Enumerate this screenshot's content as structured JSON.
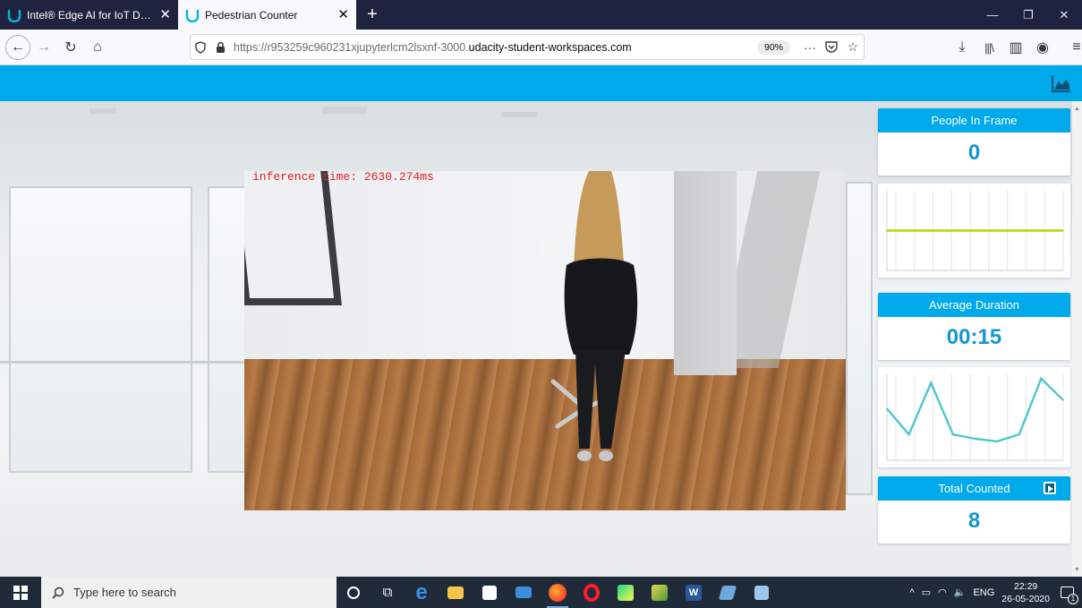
{
  "browser": {
    "tabs": [
      {
        "label": "Intel® Edge AI for IoT Develope",
        "active": false
      },
      {
        "label": "Pedestrian Counter",
        "active": true
      }
    ],
    "url": {
      "prefix": "https://r953259c960231xjupyterlcm2lsxnf-3000.",
      "domain": "udacity-student-workspaces.com"
    },
    "zoom": "90%"
  },
  "video": {
    "inference_text": "inference time: 2630.274ms"
  },
  "stats": {
    "people_in_frame": {
      "label": "People In Frame",
      "value": "0"
    },
    "average_duration": {
      "label": "Average Duration",
      "value": "00:15"
    },
    "total_counted": {
      "label": "Total Counted",
      "value": "8"
    }
  },
  "chart_data": [
    {
      "type": "line",
      "title": "",
      "series": [
        {
          "values": [
            50,
            50,
            50,
            50,
            50,
            50,
            50,
            50,
            50,
            50
          ]
        }
      ],
      "ylim": [
        0,
        100
      ],
      "color": "#b6d600"
    },
    {
      "type": "line",
      "title": "",
      "series": [
        {
          "values": [
            60,
            30,
            90,
            30,
            25,
            22,
            30,
            95,
            70
          ]
        }
      ],
      "ylim": [
        0,
        100
      ],
      "color": "#4ec7cc"
    }
  ],
  "taskbar": {
    "search_placeholder": "Type here to search",
    "language": "ENG",
    "time": "22:29",
    "date": "26-05-2020",
    "notification_count": "1"
  },
  "colors": {
    "accent": "#00a9e9",
    "value_text": "#1596d3",
    "taskbar": "#1f2b39"
  }
}
